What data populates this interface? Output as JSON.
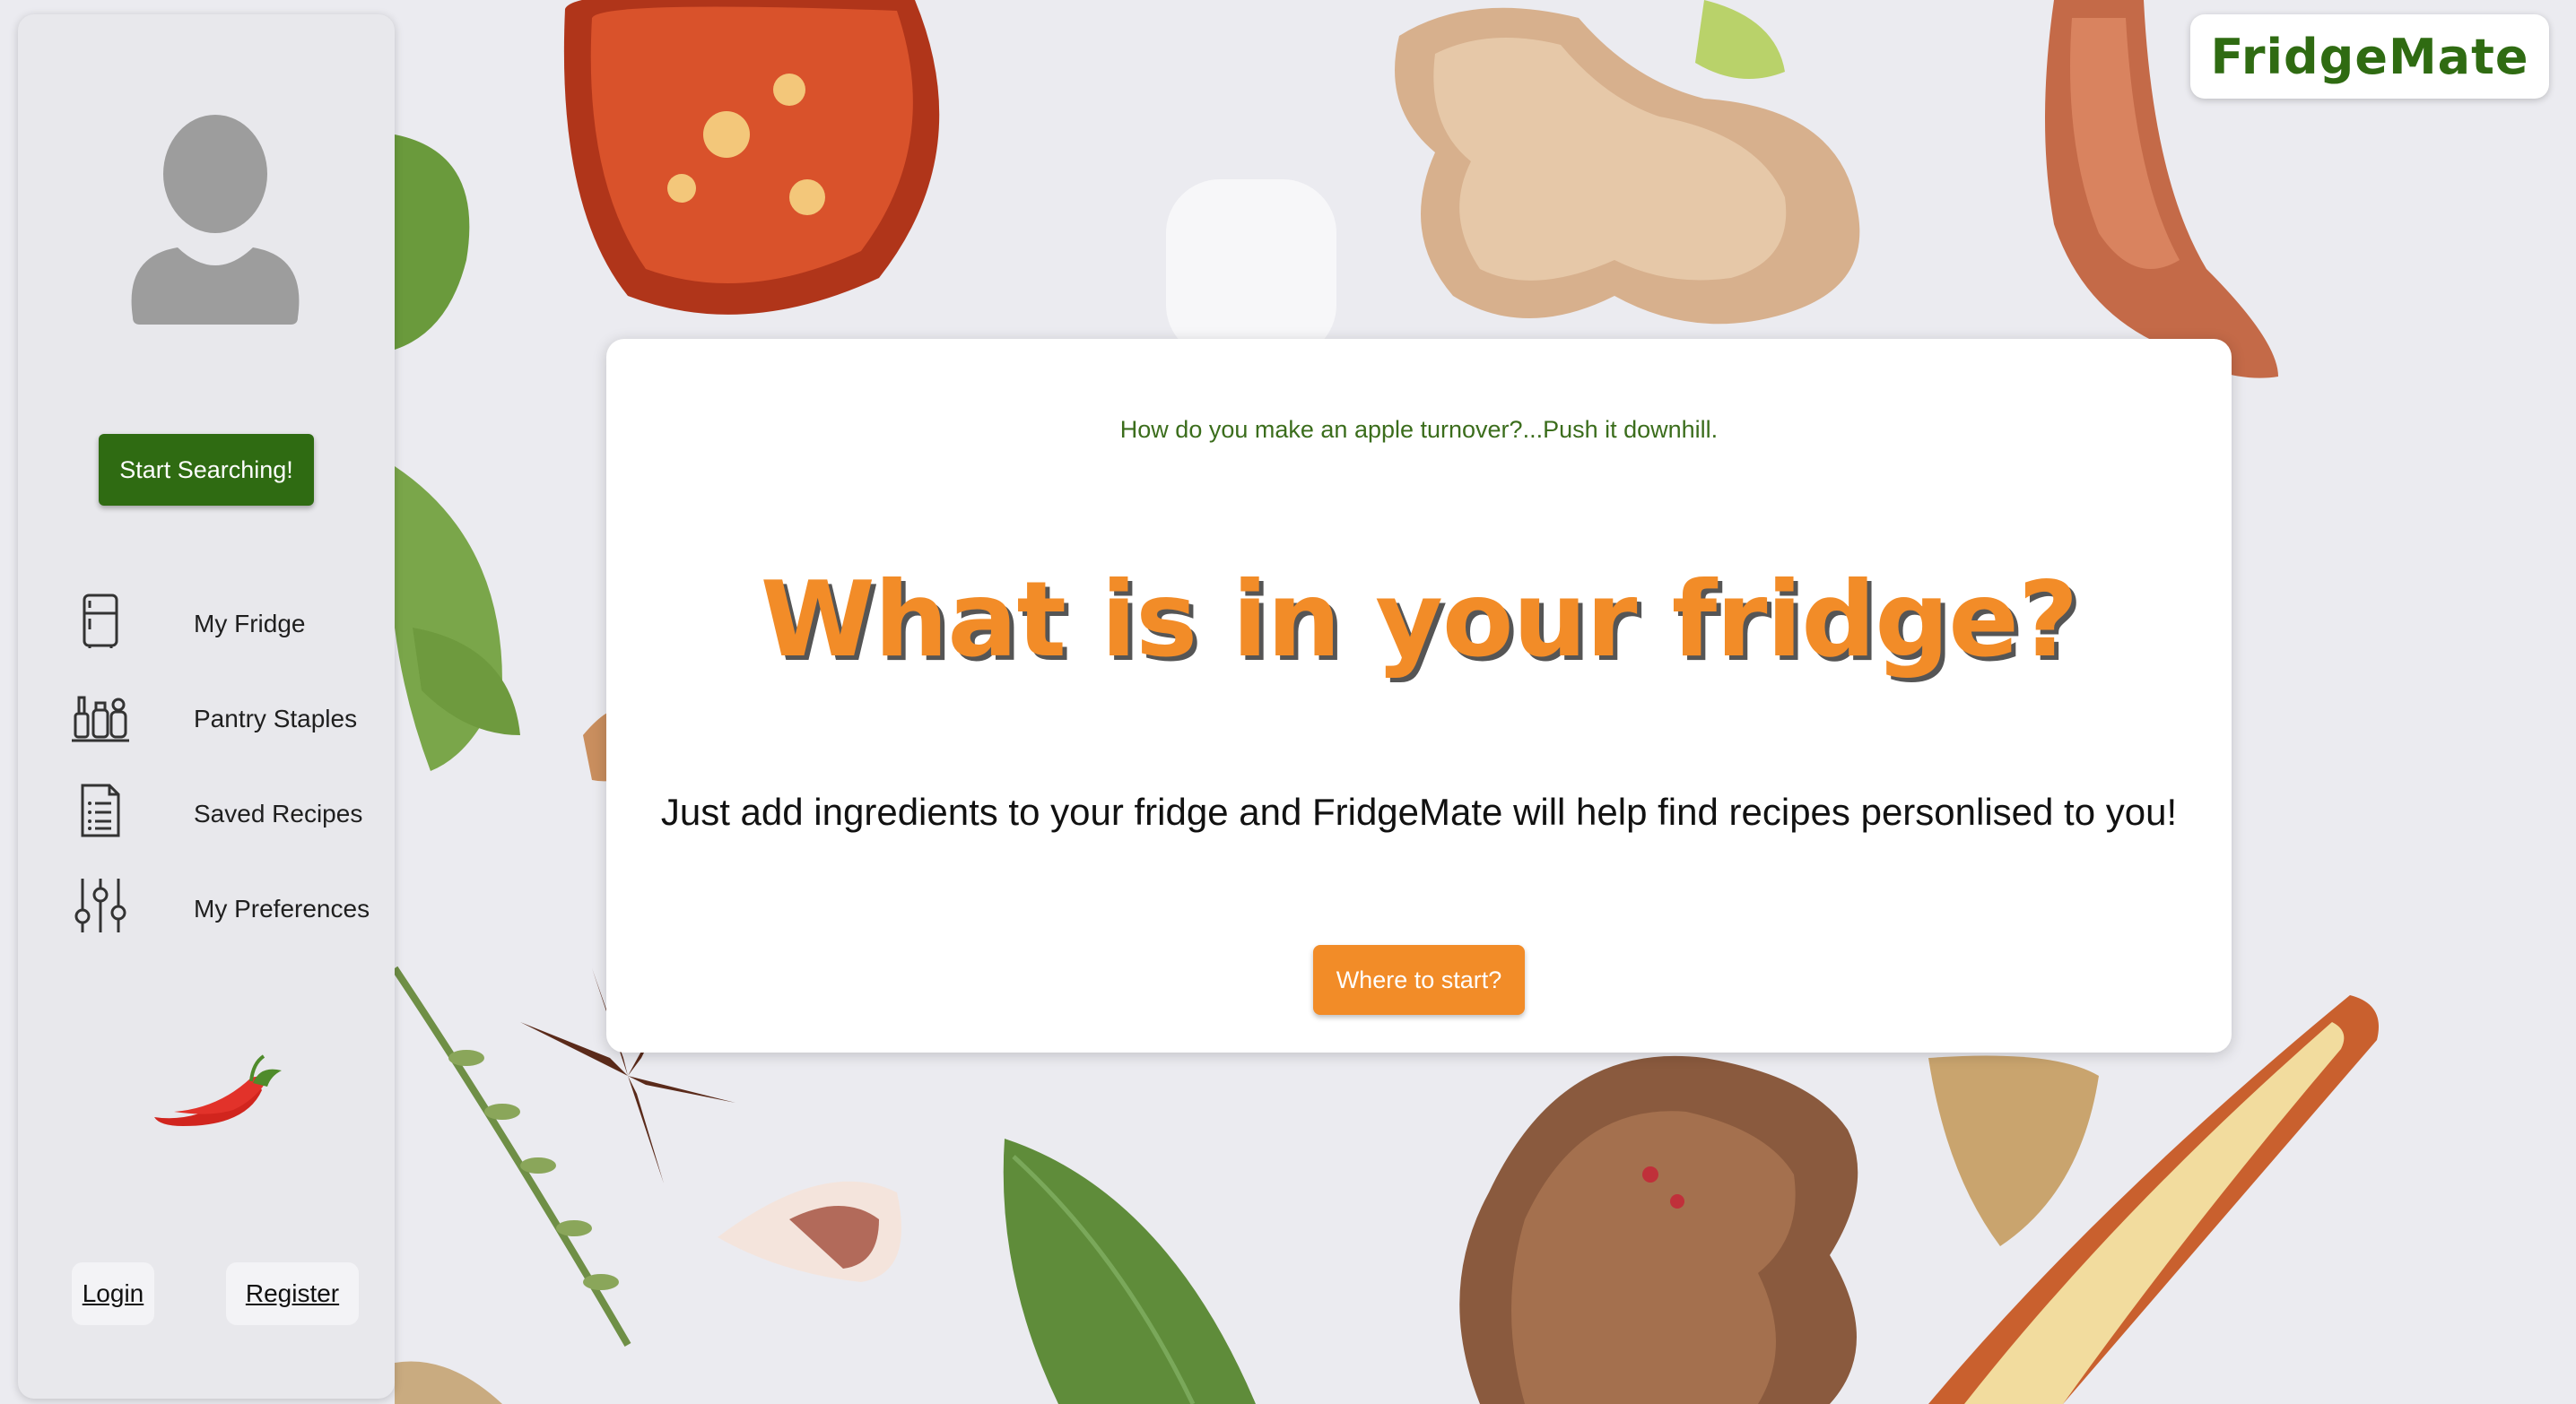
{
  "brand": {
    "name": "FridgeMate",
    "color": "#2f6b12"
  },
  "sidebar": {
    "start_button": "Start Searching!",
    "items": [
      {
        "label": "My Fridge",
        "icon": "fridge-icon"
      },
      {
        "label": "Pantry Staples",
        "icon": "pantry-jars-icon"
      },
      {
        "label": "Saved Recipes",
        "icon": "recipe-list-icon"
      },
      {
        "label": "My Preferences",
        "icon": "sliders-icon"
      }
    ],
    "decoration_icon": "chilli-pepper-icon",
    "login_label": "Login",
    "register_label": "Register"
  },
  "main": {
    "joke": "How do you make an apple turnover?...Push it downhill.",
    "headline": "What is in your fridge?",
    "subline": "Just add ingredients to your fridge and FridgeMate will help find recipes personlised to you!",
    "cta_label": "Where to start?"
  },
  "colors": {
    "primary_green": "#2f6b12",
    "accent_orange": "#f28c28",
    "sidebar_bg": "#e8e8ec"
  }
}
